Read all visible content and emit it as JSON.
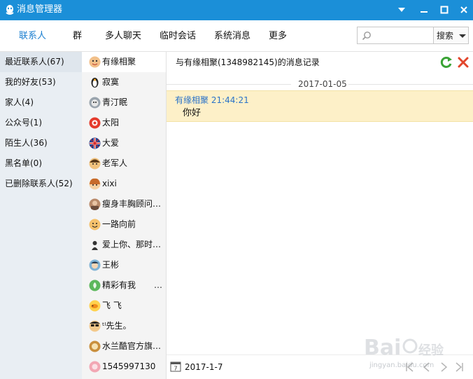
{
  "window": {
    "title": "消息管理器"
  },
  "nav": {
    "tabs": [
      {
        "label": "联系人",
        "active": true
      },
      {
        "label": "群"
      },
      {
        "label": "多人聊天"
      },
      {
        "label": "临时会话"
      },
      {
        "label": "系统消息"
      },
      {
        "label": "更多"
      }
    ],
    "search_value": "",
    "search_button": "搜索"
  },
  "categories": [
    {
      "label": "最近联系人(67)",
      "active": true
    },
    {
      "label": "我的好友(53)"
    },
    {
      "label": "家人(4)"
    },
    {
      "label": "公众号(1)"
    },
    {
      "label": "陌生人(36)"
    },
    {
      "label": "黑名单(0)"
    },
    {
      "label": "已删除联系人(52)"
    }
  ],
  "contacts": [
    {
      "name": "有缘相聚",
      "avatar": "cartoon-face-avatar",
      "active": true
    },
    {
      "name": "寂寞",
      "avatar": "penguin-avatar"
    },
    {
      "name": "青汀眠",
      "avatar": "dog-avatar"
    },
    {
      "name": "太阳",
      "avatar": "red-sun-avatar"
    },
    {
      "name": "大爱",
      "avatar": "union-jack-avatar"
    },
    {
      "name": "老军人",
      "avatar": "boy-face-avatar"
    },
    {
      "name": "xixi",
      "avatar": "girl-face-avatar"
    },
    {
      "name": "瘦身丰胸顾问…",
      "avatar": "photo-avatar"
    },
    {
      "name": "一路向前",
      "avatar": "smiley-avatar"
    },
    {
      "name": "爱上你、那时…",
      "avatar": "silhouette-avatar"
    },
    {
      "name": "王彬",
      "avatar": "cartoon-man-avatar"
    },
    {
      "name": "精彩有我",
      "avatar": "green-leaf-avatar",
      "extra": "…"
    },
    {
      "name": "飞 飞",
      "avatar": "yellow-fish-avatar"
    },
    {
      "name": "ᵗˡ先生。",
      "avatar": "sunglasses-avatar"
    },
    {
      "name": "水兰酷官方旗…",
      "avatar": "brand-avatar"
    },
    {
      "name": "1545997130",
      "avatar": "pink-avatar"
    }
  ],
  "main": {
    "header": "与有缘相聚(1348982145)的消息记录",
    "date_separator": "2017-01-05",
    "message": {
      "sender_time": "有缘相聚 21:44:21",
      "text": "你好"
    },
    "bottom_date": "2017-1-7",
    "calendar_day": "7"
  },
  "watermark": {
    "url": "jingyan.baidu.com"
  },
  "colors": {
    "titlebar": "#1b8fd8",
    "active_tab": "#1b7fd0",
    "message_bg": "#fdf0c8",
    "sender": "#2b73c8"
  }
}
